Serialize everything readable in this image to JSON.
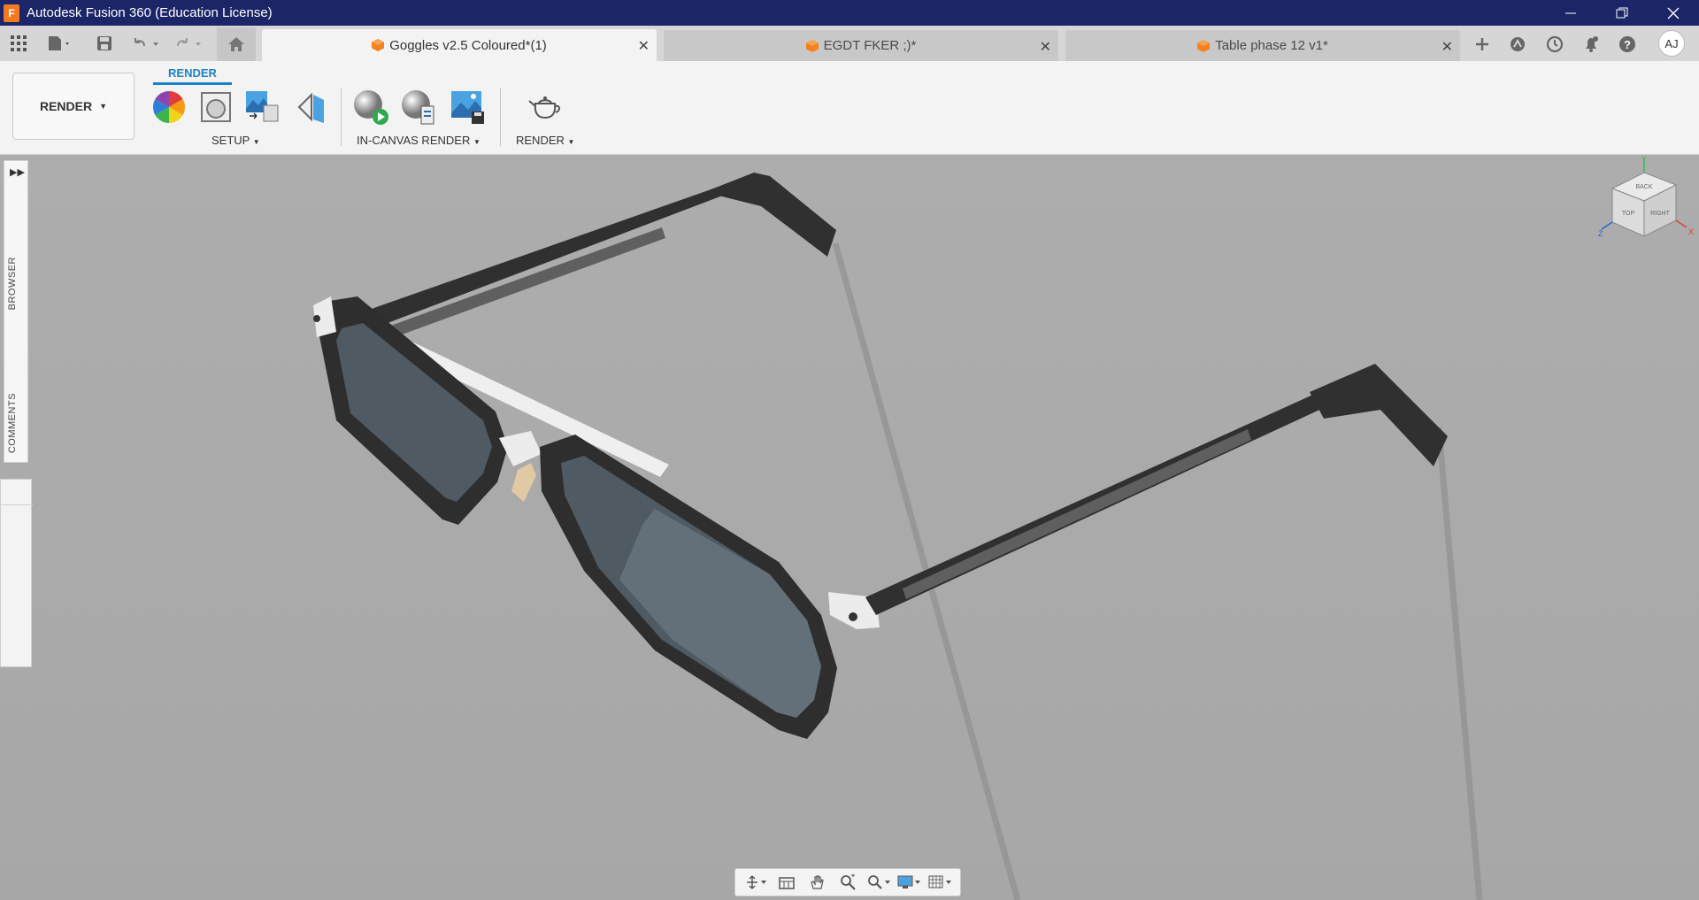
{
  "window": {
    "title": "Autodesk Fusion 360 (Education License)",
    "logo_letter": "F"
  },
  "tabs": [
    {
      "label": "Goggles v2.5 Coloured*(1)",
      "active": true
    },
    {
      "label": "EGDT FKER ;)*",
      "active": false
    },
    {
      "label": "Table phase 12 v1*",
      "active": false
    }
  ],
  "user": {
    "initials": "AJ"
  },
  "toolbar": {
    "workspace": "RENDER",
    "workspace_tab": "RENDER",
    "groups": {
      "setup": "SETUP",
      "in_canvas": "IN-CANVAS RENDER",
      "render": "RENDER"
    }
  },
  "panels": {
    "browser": "BROWSER",
    "comments": "COMMENTS"
  },
  "viewcube": {
    "faces": [
      "TOP",
      "RIGHT",
      "BACK"
    ],
    "axes": [
      "Y",
      "Z",
      "X"
    ]
  },
  "colors": {
    "titlebar": "#1b2568",
    "accent": "#1b83c5",
    "tab_cube": "#f58220",
    "frame": "#2e2e2e",
    "lens": "#4f5a63",
    "canvas": "#aaaaaa"
  }
}
